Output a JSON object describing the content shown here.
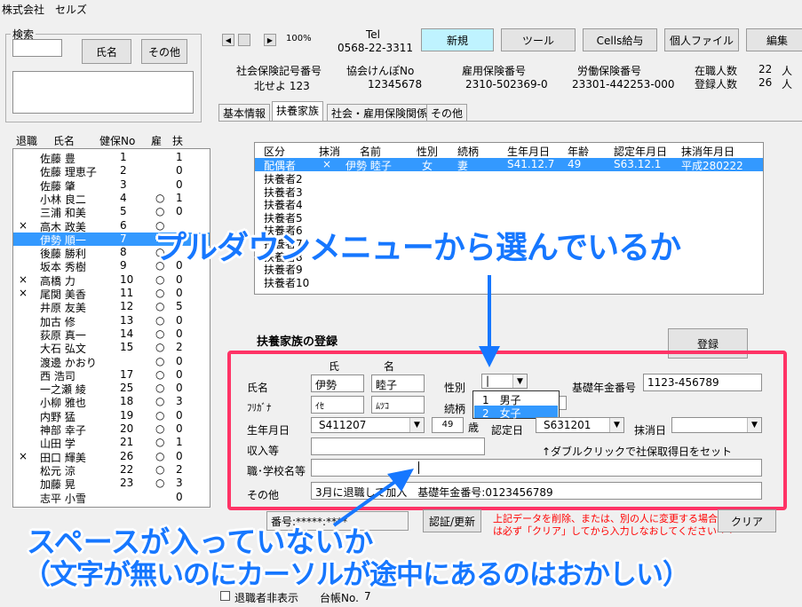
{
  "window_title": "株式会社　セルズ",
  "search": {
    "group_label": "検索",
    "name_btn": "氏名",
    "other_btn": "その他"
  },
  "emp_list": {
    "headers": [
      "退職",
      "氏名",
      "健保No",
      "雇",
      "扶"
    ],
    "rows": [
      {
        "ret": "",
        "name": "佐藤 豊",
        "no": "1",
        "emp": "",
        "dep": "1"
      },
      {
        "ret": "",
        "name": "佐藤 理恵子",
        "no": "2",
        "emp": "",
        "dep": "0"
      },
      {
        "ret": "",
        "name": "佐藤 肇",
        "no": "3",
        "emp": "",
        "dep": "0"
      },
      {
        "ret": "",
        "name": "小林 良二",
        "no": "4",
        "emp": "○",
        "dep": "1"
      },
      {
        "ret": "",
        "name": "三浦 和美",
        "no": "5",
        "emp": "○",
        "dep": "0"
      },
      {
        "ret": "×",
        "name": "高木 政美",
        "no": "6",
        "emp": "○",
        "dep": ""
      },
      {
        "ret": "",
        "name": "伊勢 順一",
        "no": "7",
        "emp": "",
        "dep": ""
      },
      {
        "ret": "",
        "name": "後藤 勝利",
        "no": "8",
        "emp": "○",
        "dep": ""
      },
      {
        "ret": "",
        "name": "坂本 秀樹",
        "no": "9",
        "emp": "○",
        "dep": "0"
      },
      {
        "ret": "×",
        "name": "高橋 力",
        "no": "10",
        "emp": "○",
        "dep": "0"
      },
      {
        "ret": "×",
        "name": "尾関 美香",
        "no": "11",
        "emp": "○",
        "dep": "0"
      },
      {
        "ret": "",
        "name": "井原 友美",
        "no": "12",
        "emp": "○",
        "dep": "5"
      },
      {
        "ret": "",
        "name": "加古 修",
        "no": "13",
        "emp": "○",
        "dep": "0"
      },
      {
        "ret": "",
        "name": "荻原 真一",
        "no": "14",
        "emp": "○",
        "dep": "0"
      },
      {
        "ret": "",
        "name": "大石 弘文",
        "no": "15",
        "emp": "○",
        "dep": "2"
      },
      {
        "ret": "",
        "name": "渡邊 かおり",
        "no": "",
        "emp": "○",
        "dep": "0"
      },
      {
        "ret": "",
        "name": "西 浩司",
        "no": "17",
        "emp": "○",
        "dep": "0"
      },
      {
        "ret": "",
        "name": "一之瀬 綾",
        "no": "25",
        "emp": "○",
        "dep": "0"
      },
      {
        "ret": "",
        "name": "小柳 雅也",
        "no": "18",
        "emp": "○",
        "dep": "3"
      },
      {
        "ret": "",
        "name": "内野 猛",
        "no": "19",
        "emp": "○",
        "dep": "0"
      },
      {
        "ret": "",
        "name": "神部 幸子",
        "no": "20",
        "emp": "○",
        "dep": "0"
      },
      {
        "ret": "",
        "name": "山田 学",
        "no": "21",
        "emp": "○",
        "dep": "1"
      },
      {
        "ret": "×",
        "name": "田口 輝美",
        "no": "26",
        "emp": "○",
        "dep": "0"
      },
      {
        "ret": "",
        "name": "松元 涼",
        "no": "22",
        "emp": "○",
        "dep": "2"
      },
      {
        "ret": "",
        "name": "加藤 晃",
        "no": "23",
        "emp": "○",
        "dep": "3"
      },
      {
        "ret": "",
        "name": "志平 小雪",
        "no": "",
        "emp": "",
        "dep": "0"
      }
    ],
    "selected_index": 6
  },
  "top": {
    "zoom": "100%",
    "tel_label": "Tel",
    "tel_value": "0568-22-3311",
    "buttons": [
      "新規",
      "ツール",
      "Cells給与",
      "個人ファイル",
      "編集"
    ]
  },
  "info": {
    "labels": [
      "社会保険記号番号",
      "協会けんぽNo",
      "雇用保険番号",
      "労働保険番号"
    ],
    "values": [
      "北せよ 123",
      "12345678",
      "2310-502369-0",
      "23301-442253-000"
    ],
    "current_label": "在職人数",
    "current_value": "22",
    "registered_label": "登録人数",
    "registered_value": "26",
    "unit": "人"
  },
  "tabs": [
    "基本情報",
    "扶養家族",
    "社会・雇用保険関係",
    "その他"
  ],
  "dependents": {
    "headers": [
      "区分",
      "抹消",
      "名前",
      "性別",
      "続柄",
      "生年月日",
      "年齢",
      "認定年月日",
      "抹消年月日"
    ],
    "first": {
      "kubun": "配偶者",
      "delete": "×",
      "name": "伊勢 睦子",
      "sex": "女",
      "rel": "妻",
      "birth": "S41.12.7",
      "age": "49",
      "cert": "S63.12.1",
      "del_date": "平成280222"
    },
    "others": [
      "扶養者2",
      "扶養者3",
      "扶養者4",
      "扶養者5",
      "扶養者6",
      "扶養者7",
      "扶養者8",
      "扶養者9",
      "扶養者10"
    ]
  },
  "form": {
    "title": "扶養家族の登録",
    "register_btn": "登録",
    "sei_header": "氏",
    "mei_header": "名",
    "name_label": "氏名",
    "sei": "伊勢",
    "mei": "睦子",
    "kana_label": "ﾌﾘｶﾞﾅ",
    "kana_sei": "ｲｾ",
    "kana_mei": "ﾑﾂｺ",
    "sex_label": "性別",
    "sex_value": "",
    "sex_options": [
      "1　男子",
      "2　女子"
    ],
    "pension_label": "基礎年金番号",
    "pension_value": "1123-456789",
    "rel_label": "続柄",
    "birth_label": "生年月日",
    "birth_value": "S411207",
    "age_value": "49",
    "age_unit": "歳",
    "cert_label": "認定日",
    "cert_value": "S631201",
    "del_label": "抹消日",
    "income_label": "収入等",
    "hint": "↑ダブルクリックで社保取得日をセット",
    "job_label": "職･学校名等",
    "other_label": "その他",
    "other_value": "3月に退職して加入　基礎年金番号:0123456789",
    "bottom_left": "番号:*****:****",
    "auth_btn": "認証/更新",
    "warning_line1": "上記データを削除、または、別の人に変更する場合",
    "warning_line2": "は必ず「クリア」してから入力しなおしてください⇒⇒",
    "clear_btn": "クリア"
  },
  "footer": {
    "hide_retired": "退職者非表示",
    "ledger_label": "台帳No.",
    "ledger_value": "7"
  },
  "annotations": {
    "dropdown": "プルダウンメニューから選んでいるか",
    "space1": "スペースが入っていないか",
    "space2": "（文字が無いのにカーソルが途中にあるのはおかしい）"
  },
  "colors": {
    "annotation": "#1677ff",
    "highlight_box": "#ff3366",
    "selection": "#3399ff"
  }
}
